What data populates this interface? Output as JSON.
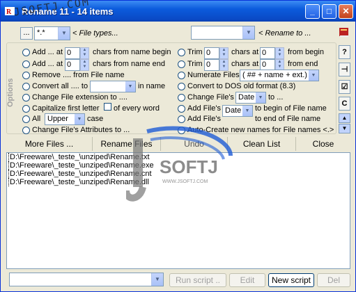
{
  "window": {
    "title": "Rename  11 - 14 items",
    "min": "_",
    "max": "□",
    "close": "✕"
  },
  "watermark": {
    "top_text": "JSOFTJ.COM",
    "logo_text": "SOFTJ",
    "logo_url": "WWW.JSOFTJ.COM"
  },
  "filter": {
    "dots_label": "...",
    "mask_value": "*.*",
    "file_types_label": "< File types...",
    "rename_to_value": "",
    "rename_to_label": "< Rename to ..."
  },
  "options_label": "Options",
  "left_opts": [
    {
      "id": "add-begin",
      "pre": "Add ... at",
      "num": "0",
      "post": "chars from name begin"
    },
    {
      "id": "add-end",
      "pre": "Add ... at",
      "num": "0",
      "post": "chars from name end"
    },
    {
      "id": "remove",
      "text": "Remove .... from File name"
    },
    {
      "id": "convert",
      "pre": "Convert all .... to",
      "post": "in name"
    },
    {
      "id": "change-ext",
      "text": "Change File extension to ...."
    },
    {
      "id": "capitalize",
      "pre": "Capitalize first letter",
      "post": "of every word"
    },
    {
      "id": "all-case",
      "pre": "All",
      "sel": "Upper",
      "post": "case"
    },
    {
      "id": "change-attr",
      "text": "Change File's Attributes to ..."
    }
  ],
  "right_opts": [
    {
      "id": "trim-begin",
      "pre": "Trim",
      "num": "0",
      "mid": "chars at",
      "num2": "0",
      "post": "from begin"
    },
    {
      "id": "trim-end",
      "pre": "Trim",
      "num": "0",
      "mid": "chars at",
      "num2": "0",
      "post": "from  end"
    },
    {
      "id": "numerate",
      "pre": "Numerate Files",
      "sel": "( ## + name + ext.)"
    },
    {
      "id": "dos",
      "text": "Convert to DOS old format  (8.3)"
    },
    {
      "id": "change-date",
      "pre": "Change File's",
      "sel": "Date",
      "post": "to ..."
    },
    {
      "id": "add-date-begin",
      "pre": "Add File's",
      "sel": "Date",
      "post": "to begin of File name"
    },
    {
      "id": "add-date-end",
      "pre": "Add File's",
      "sel": "Date",
      "post": "to end of File name"
    },
    {
      "id": "auto-create",
      "text": "Auto-Create new names for File names <.>"
    }
  ],
  "side": {
    "help": "?",
    "pin": "⊣",
    "check": "☑",
    "c": "C",
    "up": "▲",
    "down": "▼"
  },
  "actions": {
    "more": "More Files ...",
    "rename": "Rename Files",
    "undo": "Undo",
    "clean": "Clean List",
    "close": "Close"
  },
  "files": [
    "D:\\Freeware\\_teste_\\unziped\\Rename.txt",
    "D:\\Freeware\\_teste_\\unziped\\Rename.exe",
    "D:\\Freeware\\_teste_\\unziped\\Rename.cnt",
    "D:\\Freeware\\_teste_\\unziped\\Rename.dll"
  ],
  "bottom": {
    "script_value": "",
    "run": "Run script ..",
    "edit": "Edit",
    "new": "New script",
    "del": "Del"
  }
}
